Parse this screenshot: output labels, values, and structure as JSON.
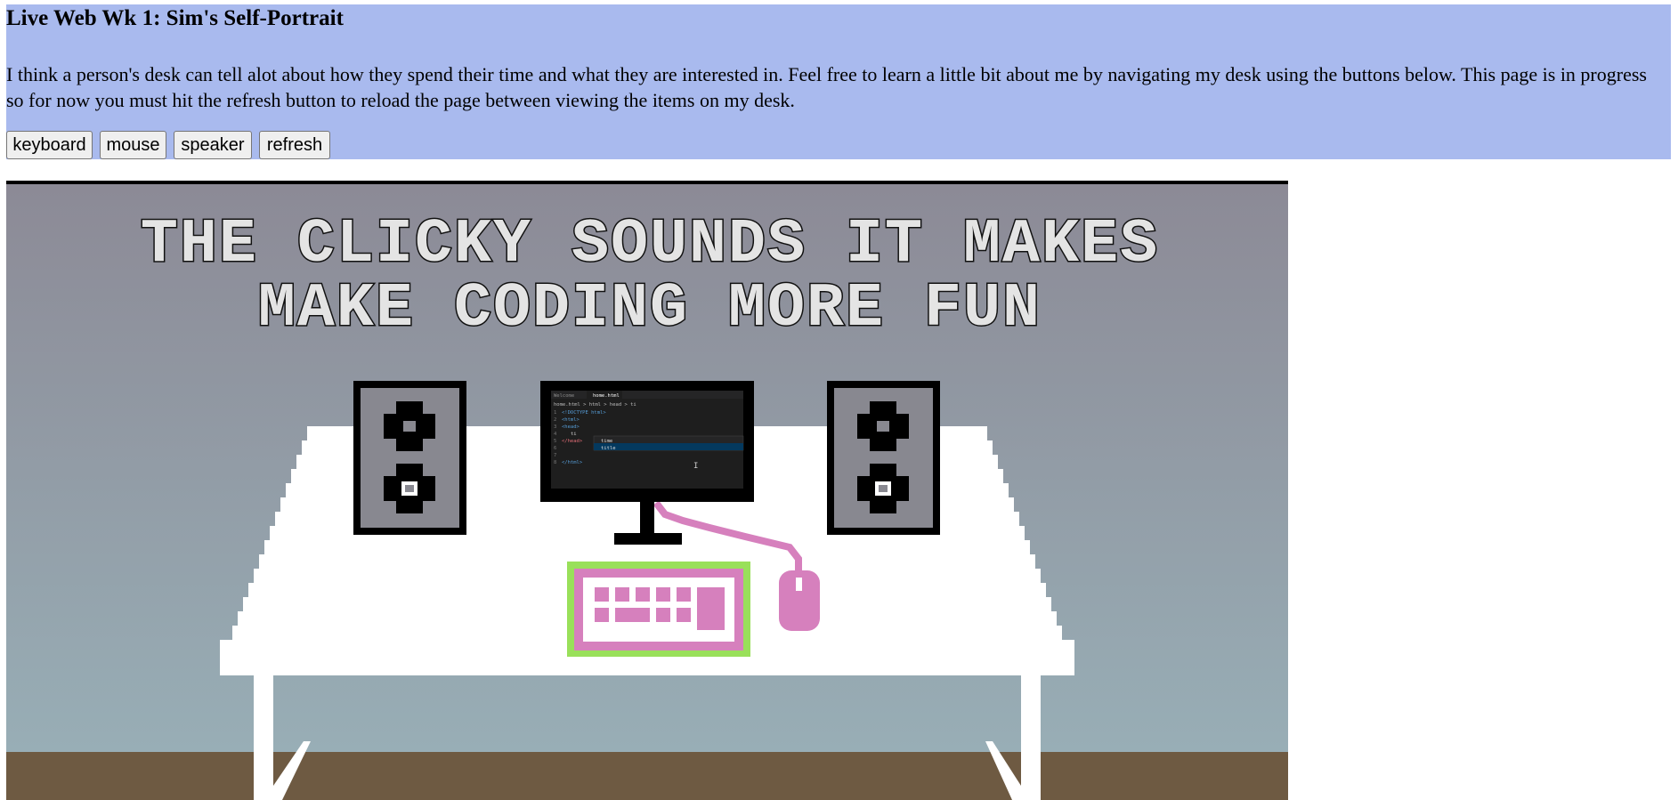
{
  "page": {
    "title": "Live Web Wk 1: Sim's Self-Portrait",
    "intro": "I think a person's desk can tell alot about how they spend their time and what they are interested in. Feel free to learn a little bit about me by navigating my desk using the buttons below. This page is in progress so for now you must hit the refresh button to reload the page between viewing the items on my desk."
  },
  "buttons": {
    "keyboard": "keyboard",
    "mouse": "mouse",
    "speaker": "speaker",
    "refresh": "refresh"
  },
  "portrait": {
    "caption_line1": "THE CLICKY SOUNDS IT MAKES",
    "caption_line2": "MAKE CODING MORE FUN",
    "editor": {
      "tabs": [
        "Welcome",
        "home.html"
      ],
      "breadcrumb": "home.html > html > head > ti",
      "lines": [
        "1",
        "2",
        "3",
        "4",
        "5",
        "6",
        "7",
        "8"
      ],
      "code": [
        "<!DOCTYPE html>",
        "<html>",
        "<head>",
        "ti",
        "</head>",
        "",
        "",
        "</html>"
      ],
      "suggestions": [
        "time",
        "title"
      ]
    }
  },
  "colors": {
    "header_bg": "#a9baee",
    "wall_top": "#8c8a96",
    "wall_bottom": "#96abb4",
    "floor": "#6e5a42",
    "accent_pink": "#d680bd",
    "accent_green": "#99e05a",
    "speaker_grey": "#888890"
  }
}
